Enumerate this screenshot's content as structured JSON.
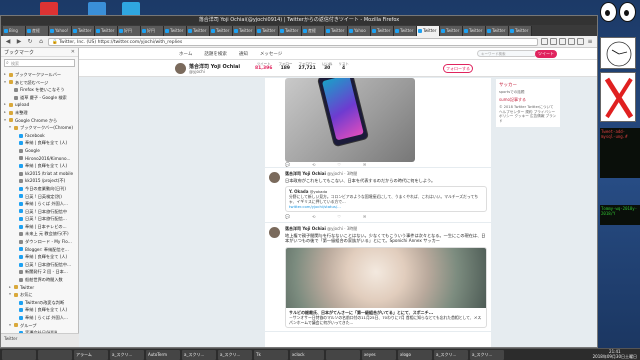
{
  "window": {
    "title": "落合洋司 Yoji Ochiai(@yjochi0914) | Twitterからの返信付きツイート - Mozilla Firefox"
  },
  "tabs": [
    "Bing",
    "産経",
    "Yahoo!",
    "Twitter",
    "Twitter",
    "好円",
    "好円",
    "Twitter",
    "Twitter",
    "Twitter",
    "Twitter",
    "Twitter",
    "Twitter",
    "産経",
    "Twitter",
    "Yahoo",
    "Twitter",
    "Twitter",
    "Twitter",
    "Twitter",
    "Twitter",
    "Twitter",
    "Twitter"
  ],
  "active_tab_index": 18,
  "navbar": {
    "url_prefix": "Twitter, Inc. (US)",
    "url": "https://twitter.com/yjochi/with_replies"
  },
  "sidebar": {
    "title": "ブックマーク",
    "search_placeholder": "検索",
    "items": [
      {
        "label": "ブックマークツールバー",
        "type": "folder",
        "level": 0,
        "tw": "▸"
      },
      {
        "label": "あとで読むページ",
        "type": "folder",
        "level": 0,
        "tw": "▾"
      },
      {
        "label": "Firefox を使いこなそう",
        "type": "page",
        "level": 1,
        "tw": ""
      },
      {
        "label": "道草 慶子 - Google 検索",
        "type": "page",
        "level": 1,
        "tw": ""
      },
      {
        "label": "upload",
        "type": "folder",
        "level": 0,
        "tw": "▸"
      },
      {
        "label": "未整理",
        "type": "folder",
        "level": 0,
        "tw": "▸"
      },
      {
        "label": "Google Chrome から",
        "type": "folder",
        "level": 0,
        "tw": "▾"
      },
      {
        "label": "ブックマークバー(Chrome)",
        "type": "folder",
        "level": 1,
        "tw": "▾"
      },
      {
        "label": "Facebook",
        "type": "web",
        "level": 2,
        "tw": ""
      },
      {
        "label": "奉納 | 良輝を全て (人)",
        "type": "web",
        "level": 2,
        "tw": ""
      },
      {
        "label": "Google",
        "type": "page",
        "level": 2,
        "tw": ""
      },
      {
        "label": "Hirono2016/Kimono...",
        "type": "page",
        "level": 2,
        "tw": ""
      },
      {
        "label": "奉納 | 良輝を全て (人)",
        "type": "web",
        "level": 2,
        "tw": ""
      },
      {
        "label": "kk2015 /triat at mobile",
        "type": "page",
        "level": 2,
        "tw": ""
      },
      {
        "label": "kk2015 /project(不)",
        "type": "page",
        "level": 2,
        "tw": ""
      },
      {
        "label": "今日の産業動向(日刊)",
        "type": "web",
        "level": 2,
        "tw": ""
      },
      {
        "label": "日英 ! 日英検定(別)",
        "type": "web",
        "level": 2,
        "tw": ""
      },
      {
        "label": "奉納 | らくば 外国人...",
        "type": "web",
        "level": 2,
        "tw": ""
      },
      {
        "label": "日英 ! 日本旅行配信中",
        "type": "web",
        "level": 2,
        "tw": ""
      },
      {
        "label": "日英 ! 日本旅行配信...",
        "type": "web",
        "level": 2,
        "tw": ""
      },
      {
        "label": "奉納 | 日本テレビの...",
        "type": "web",
        "level": 2,
        "tw": ""
      },
      {
        "label": "未来上 元 教会旅行(不)",
        "type": "page",
        "level": 2,
        "tw": ""
      },
      {
        "label": "ダウンロード - My Flo...",
        "type": "page",
        "level": 2,
        "tw": ""
      },
      {
        "label": "Blogger: 奉納配信セ...",
        "type": "web",
        "level": 2,
        "tw": ""
      },
      {
        "label": "奉納 | 良輝を全て (人)",
        "type": "web",
        "level": 2,
        "tw": ""
      },
      {
        "label": "日英 ! 日本旅行配信中...",
        "type": "web",
        "level": 2,
        "tw": ""
      },
      {
        "label": "新聞発行 2 回 - 日本...",
        "type": "page",
        "level": 2,
        "tw": ""
      },
      {
        "label": "船舶世界の時間入数",
        "type": "page",
        "level": 2,
        "tw": ""
      },
      {
        "label": "Twitter",
        "type": "folder",
        "level": 1,
        "tw": "▸"
      },
      {
        "label": "お気に",
        "type": "folder",
        "level": 1,
        "tw": "▾"
      },
      {
        "label": "Twitterの改変な判断",
        "type": "web",
        "level": 2,
        "tw": ""
      },
      {
        "label": "奉納 | 良輝を全て (人)",
        "type": "web",
        "level": 2,
        "tw": ""
      },
      {
        "label": "奉納 | らくば 外国人...",
        "type": "web",
        "level": 2,
        "tw": ""
      },
      {
        "label": "グループ",
        "type": "folder",
        "level": 1,
        "tw": "▾"
      },
      {
        "label": "実運会社日/HXJA",
        "type": "web",
        "level": 2,
        "tw": ""
      }
    ],
    "bottom_text": "Twitter"
  },
  "twitter": {
    "nav": [
      "ホーム",
      "話題を検索",
      "通知",
      "メッセージ"
    ],
    "search_placeholder": "キーワード検索",
    "tweet_button": "ツイート",
    "profile": {
      "name": "落合洋司 Yoji Ochiai",
      "handle": "@yjochi",
      "follow_button": "フォローする"
    },
    "stats": [
      {
        "label": "ツイート",
        "value": "81,396"
      },
      {
        "label": "フォロー",
        "value": "189"
      },
      {
        "label": "フォロワー",
        "value": "27,721"
      },
      {
        "label": "いいね",
        "value": "30"
      },
      {
        "label": "リスト",
        "value": "4"
      }
    ],
    "tweets": [
      {
        "name": "落合洋司 Yoji Ochiai",
        "handle": "@yjochi",
        "time": "3時間",
        "text": "日本政府がこれをしてもこない、日本を代表するのだからの時代に何をしよう。",
        "quote_name": "Y. Okada",
        "quote_handle": "@yokada",
        "quote_text": "分野にして新しい見方。コロンビアのような国境接近にして、うまくやれば、これはいい。マルチーズだってちゃ、イギリスに押している方で...",
        "quote_link": "twitter.com/yjochi/status/...",
        "replies": "",
        "retweets": "",
        "likes": ""
      },
      {
        "name": "落合洋司 Yoji Ochiai",
        "handle": "@yjochi",
        "time": "3時間",
        "text": "地上権で親子間関与を行なないことはない。少なくてもこういう事件は次々となる。一生にこの現在は、日本がいつもの後で「第一級組合の家族がいる」とにて。Sponichi Annex サッカー",
        "card_title": "サルビの総裁氏、日本がてんさーに「第一級組合がいてる」とにて、スポニチ...",
        "card_text": "－サンオサー日特協のマルソの名前口付の11月25日、70わりに7月 首相に知らなとても忘れた首相として、メスパンホームで議会に何がいってきた..."
      }
    ],
    "right_panel": {
      "title": "サッカー",
      "sub": "sportsでの話題",
      "link": "sumo記事する",
      "text": "© 2018 Twitter  Twitterについて ヘルプセンター 規約 プライバシーポリシー クッキー 広告情報 ブランド"
    }
  },
  "taskbar": {
    "items": [
      "",
      "",
      "アラーム",
      "a_スクリ...",
      "AutoTerm",
      "a_スクリ...",
      "a_スクリ...",
      "Tk",
      "xclock",
      "",
      "xeyes",
      "xlogo",
      "a_スクリ...",
      "a_スクリ..."
    ],
    "time": "21:41",
    "date": "2018年09月30日土曜日"
  },
  "desktop": {
    "term_red": "Tweet-add-mysql-ung.#",
    "term_green": "Tommy-wq-2018y-2018/Y"
  }
}
